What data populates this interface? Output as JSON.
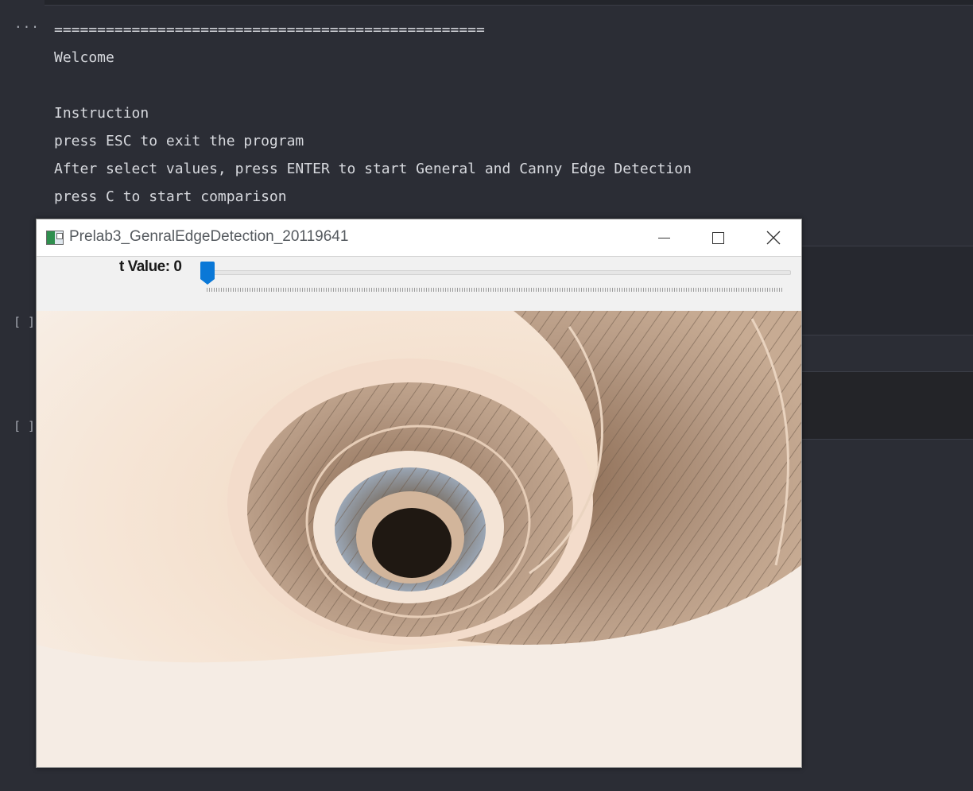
{
  "notebook": {
    "gutter_ellipsis": "...",
    "output_lines": [
      "==================================================",
      "Welcome",
      "",
      "Instruction",
      "press ESC to exit the program",
      "After select values, press ENTER to start General and Canny Edge Detection",
      "press C to start comparison"
    ],
    "cell_brackets": [
      "[ ]",
      "[ ]"
    ]
  },
  "window": {
    "title": "Prelab3_GenralEdgeDetection_20119641",
    "close_glyph": "✕"
  },
  "trackbar": {
    "label": "t Value: 0",
    "value": 0
  },
  "image": {
    "subject": "spiral staircase viewed from above"
  },
  "colors": {
    "editor_bg": "#2b2d35",
    "text": "#d7d9de",
    "trackbar_thumb": "#0a78d7"
  }
}
